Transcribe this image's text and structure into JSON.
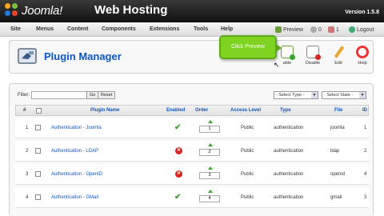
{
  "header": {
    "logo_text": "Joomla!",
    "site_name": "Web Hosting",
    "version": "Version 1.5.8"
  },
  "menu": {
    "items": [
      "Site",
      "Menus",
      "Content",
      "Components",
      "Extensions",
      "Tools",
      "Help"
    ],
    "status": {
      "preview": "Preview",
      "messages": "0",
      "users": "1",
      "logout": "Logout"
    }
  },
  "toolbar": {
    "title": "Plugin Manager",
    "buttons": [
      "Enable",
      "Disable",
      "Edit",
      "Help"
    ],
    "enable_partial": "able"
  },
  "tooltip": {
    "text": "Click Preview"
  },
  "filter": {
    "label": "Filter:",
    "input_value": "",
    "go_label": "Go",
    "reset_label": "Reset",
    "type_select": "- Select Type -",
    "state_select": "- Select State -"
  },
  "table": {
    "columns": {
      "num": "#",
      "name": "Plugin Name",
      "enabled": "Enabled",
      "order": "Order",
      "access": "Access Level",
      "type": "Type",
      "file": "File",
      "id": "ID"
    },
    "rows": [
      {
        "num": "1",
        "name": "Authentication - Joomla",
        "enabled": true,
        "order": "1",
        "access": "Public",
        "type": "authentication",
        "file": "joomla",
        "id": "1"
      },
      {
        "num": "2",
        "name": "Authentication - LDAP",
        "enabled": false,
        "order": "2",
        "access": "Public",
        "type": "authentication",
        "file": "ldap",
        "id": "2"
      },
      {
        "num": "3",
        "name": "Authentication - OpenID",
        "enabled": false,
        "order": "3",
        "access": "Public",
        "type": "authentication",
        "file": "openid",
        "id": "4"
      },
      {
        "num": "4",
        "name": "Authentication - GMail",
        "enabled": true,
        "order": "4",
        "access": "Public",
        "type": "authentication",
        "file": "gmail",
        "id": "3"
      }
    ]
  },
  "colors": {
    "link": "#0b55c4",
    "header_bg": "#1a1a1a",
    "tooltip_bg": "#7ed321",
    "enabled_green": "#3aa52c",
    "disabled_red": "#dd2222"
  }
}
